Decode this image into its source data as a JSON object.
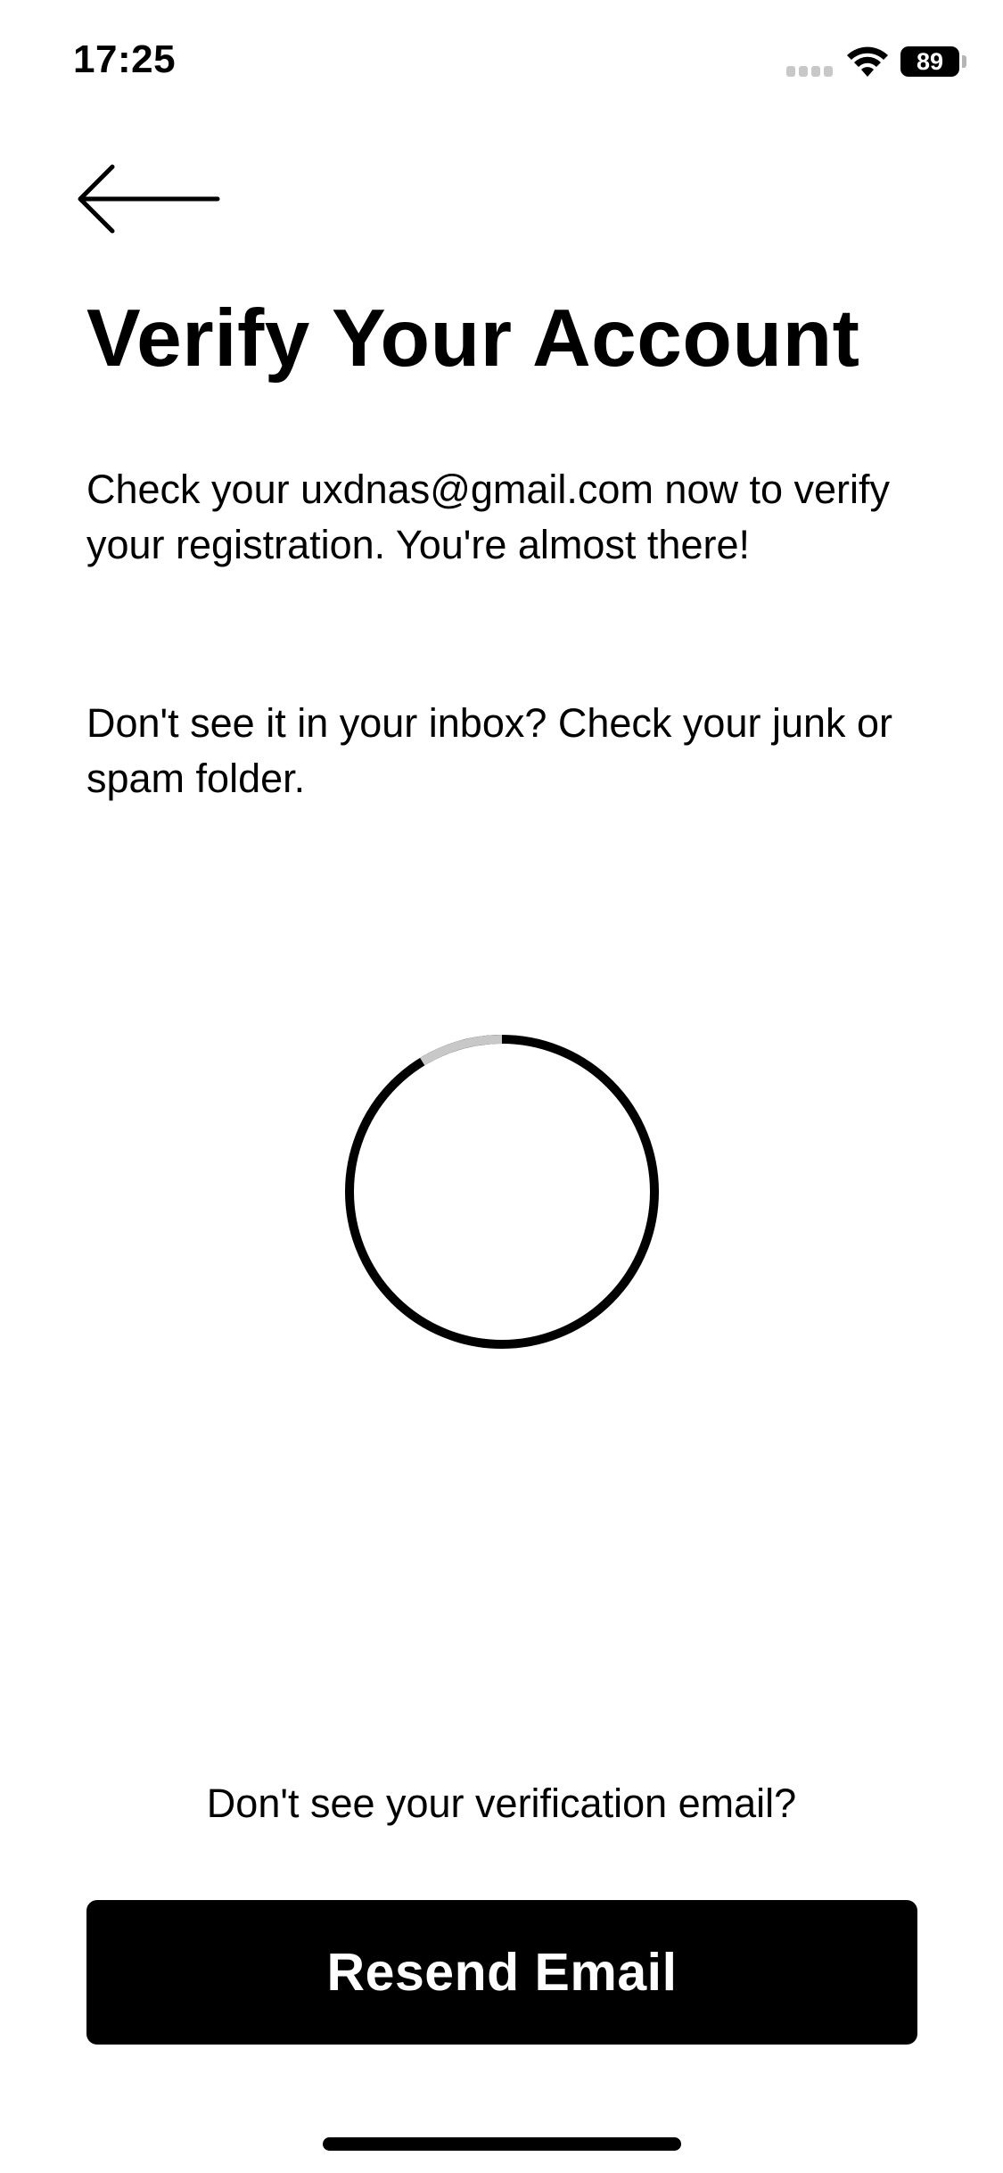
{
  "status_bar": {
    "time": "17:25",
    "battery": "89",
    "icons": [
      "signal-icon",
      "wifi-icon",
      "battery-icon"
    ]
  },
  "nav": {
    "back_icon": "arrow-left-icon"
  },
  "content": {
    "title": "Verify Your Account",
    "message": "Check your uxdnas@gmail.com now to verify your registration. You're almost there!",
    "hint": "Don't see it in your inbox? Check your junk or spam folder."
  },
  "spinner": {
    "icon": "loading-spinner-icon",
    "track_color": "#000000",
    "highlight_color": "#c8c8c8"
  },
  "footer": {
    "prompt": "Don't see your verification email?",
    "resend_label": "Resend Email"
  },
  "colors": {
    "background": "#ffffff",
    "text": "#000000",
    "button_bg": "#000000",
    "button_text": "#ffffff"
  }
}
